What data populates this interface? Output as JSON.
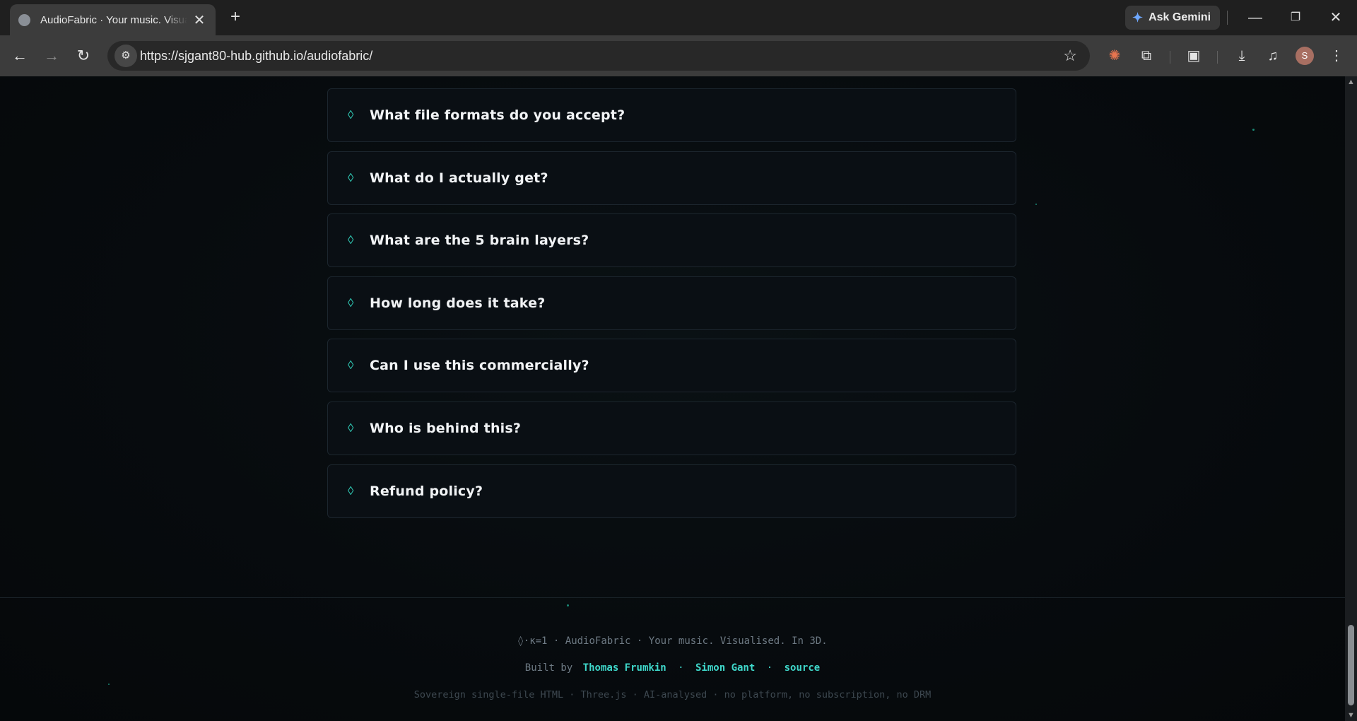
{
  "browser": {
    "tab_title": "AudioFabric · Your music. Visualised. In 3D.",
    "tab_close": "✕",
    "new_tab": "+",
    "ask_gemini": "Ask Gemini",
    "url": "https://sjgant80-hub.github.io/audiofabric/",
    "avatar_letter": "S",
    "window_minimize": "—",
    "window_restore": "❐",
    "window_close": "✕"
  },
  "faq": {
    "items": [
      {
        "question": "What file formats do you accept?"
      },
      {
        "question": "What do I actually get?"
      },
      {
        "question": "What are the 5 brain layers?"
      },
      {
        "question": "How long does it take?"
      },
      {
        "question": "Can I use this commercially?"
      },
      {
        "question": "Who is behind this?"
      },
      {
        "question": "Refund policy?"
      }
    ],
    "marker": "◊"
  },
  "footer": {
    "line1": "◊·κ=1 · AudioFabric · Your music. Visualised. In 3D.",
    "built_by": "Built by",
    "author1": "Thomas Frumkin",
    "author2": "Simon Gant",
    "source": "source",
    "separator": "·",
    "line3": "Sovereign single-file HTML · Three.js · AI-analysed · no platform, no subscription, no DRM"
  },
  "colors": {
    "accent": "#2fc4b0",
    "link": "#3fd8cb",
    "background": "#06090c"
  }
}
